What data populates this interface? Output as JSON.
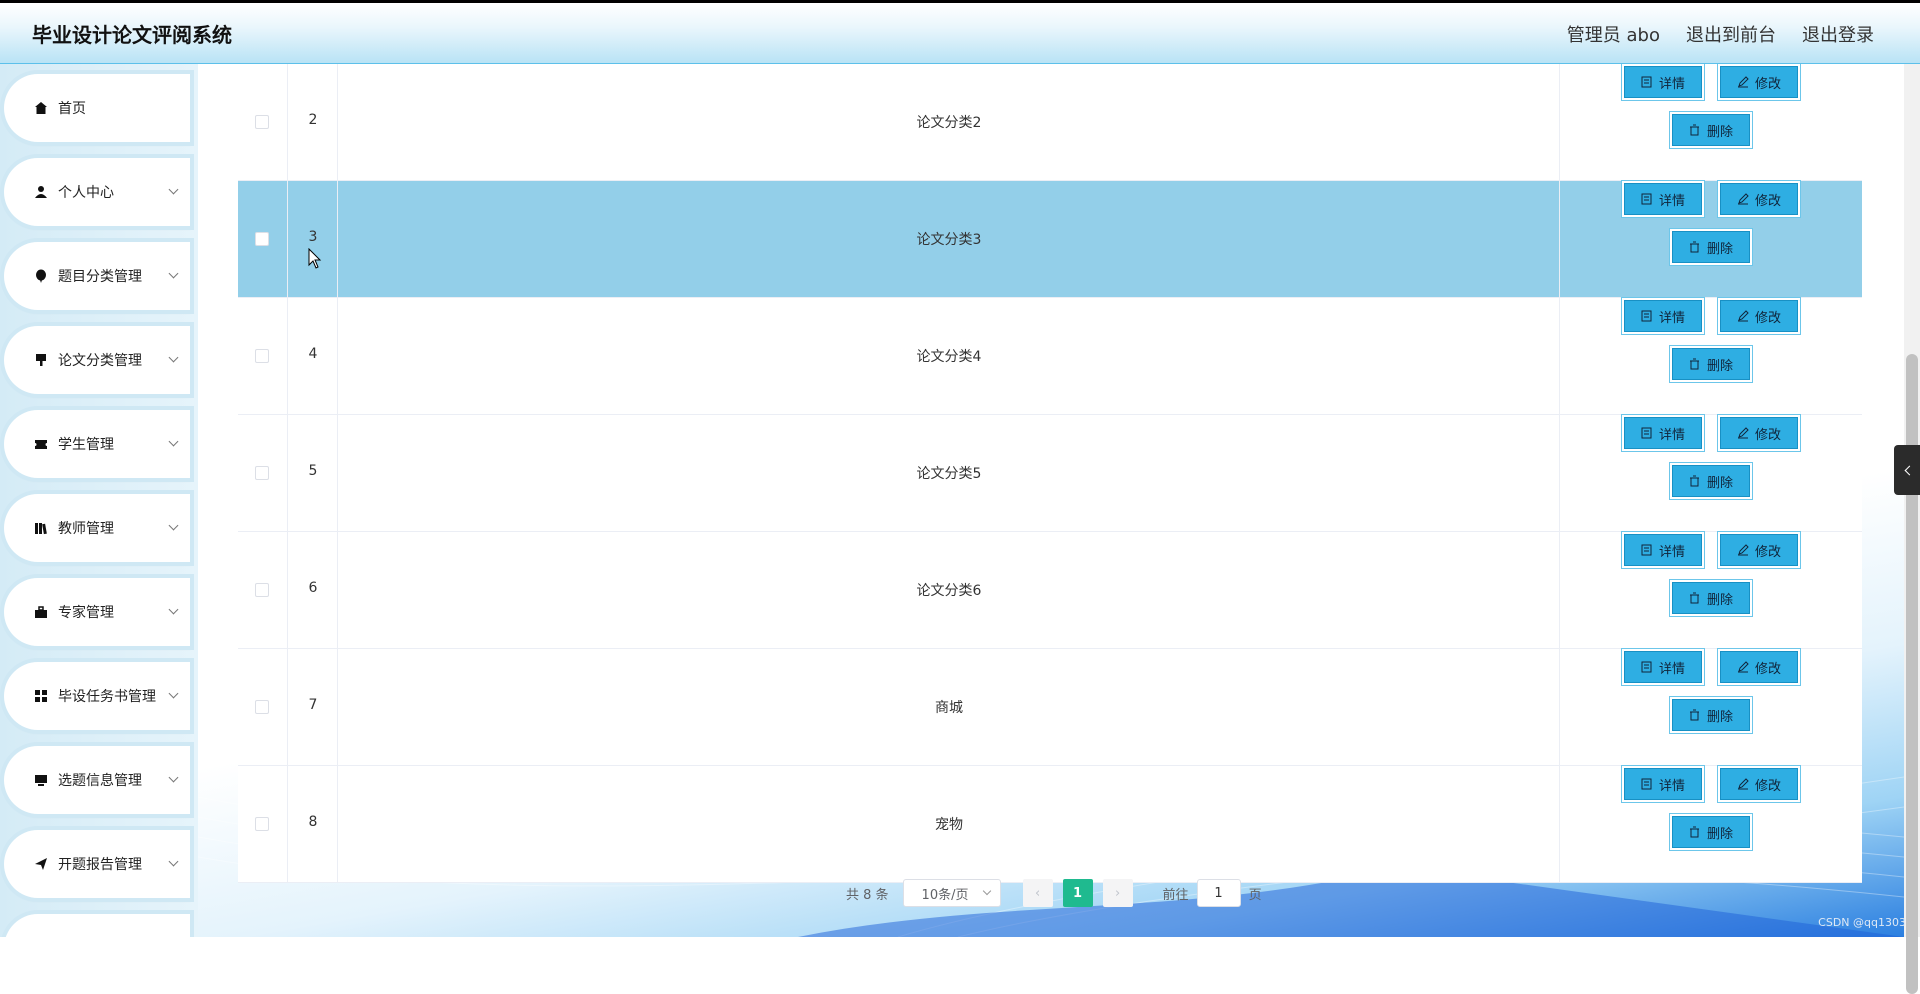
{
  "header": {
    "title": "毕业设计论文评阅系统",
    "user": "管理员 abo",
    "to_front": "退出到前台",
    "logout": "退出登录"
  },
  "sidebar": {
    "items": [
      {
        "label": "首页",
        "icon": "home-icon"
      },
      {
        "label": "个人中心",
        "icon": "user-icon"
      },
      {
        "label": "题目分类管理",
        "icon": "balloon-icon"
      },
      {
        "label": "论文分类管理",
        "icon": "brush-icon"
      },
      {
        "label": "学生管理",
        "icon": "ticket-icon"
      },
      {
        "label": "教师管理",
        "icon": "books-icon"
      },
      {
        "label": "专家管理",
        "icon": "suitcase-icon"
      },
      {
        "label": "毕设任务书管理",
        "icon": "grid-icon"
      },
      {
        "label": "选题信息管理",
        "icon": "monitor-icon"
      },
      {
        "label": "开题报告管理",
        "icon": "send-icon"
      }
    ]
  },
  "table": {
    "buttons": {
      "detail": "详情",
      "edit": "修改",
      "delete": "删除"
    },
    "rows": [
      {
        "index": "2",
        "name": "论文分类2",
        "selected": false
      },
      {
        "index": "3",
        "name": "论文分类3",
        "selected": true
      },
      {
        "index": "4",
        "name": "论文分类4",
        "selected": false
      },
      {
        "index": "5",
        "name": "论文分类5",
        "selected": false
      },
      {
        "index": "6",
        "name": "论文分类6",
        "selected": false
      },
      {
        "index": "7",
        "name": "商城",
        "selected": false
      },
      {
        "index": "8",
        "name": "宠物",
        "selected": false
      }
    ]
  },
  "pagination": {
    "total": "共 8 条",
    "page_size": "10条/页",
    "prev": "‹",
    "current_page": "1",
    "next": "›",
    "goto_label": "前往",
    "goto_value": "1",
    "page_unit": "页"
  },
  "watermark": "CSDN @qq1303",
  "colors": {
    "accent": "#2eaee3",
    "selected_row": "#93cfe9",
    "pager_current": "#1fba8f"
  }
}
